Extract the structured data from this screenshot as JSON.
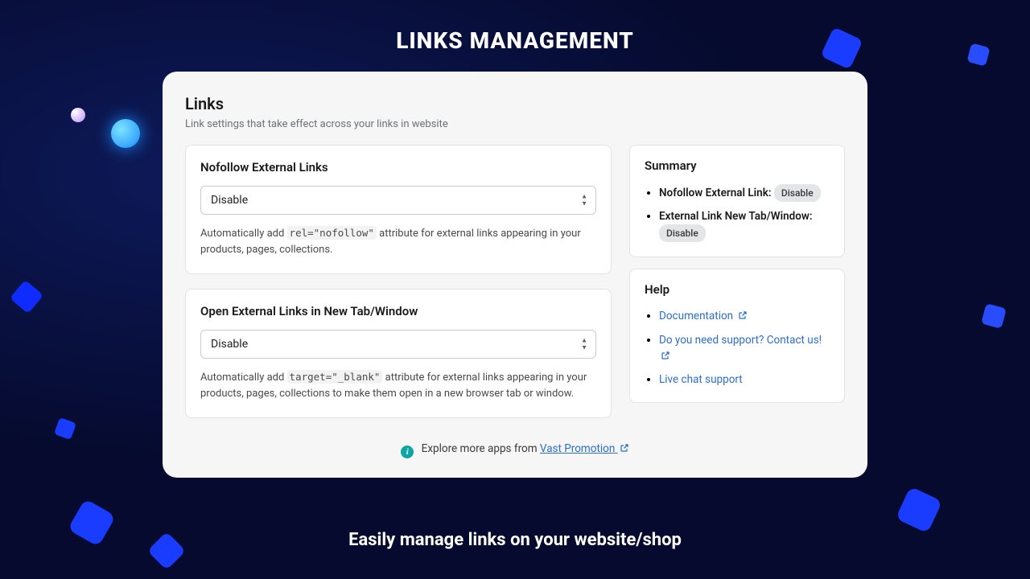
{
  "page": {
    "title": "LINKS MANAGEMENT",
    "tagline": "Easily manage links on your website/shop"
  },
  "panel": {
    "heading": "Links",
    "subheading": "Link settings that take effect across your links in website"
  },
  "cards": {
    "nofollow": {
      "title": "Nofollow External Links",
      "select_value": "Disable",
      "help_pre": "Automatically add ",
      "help_code": "rel=\"nofollow\"",
      "help_post": " attribute for external links appearing in your products, pages, collections."
    },
    "newtab": {
      "title": "Open External Links in New Tab/Window",
      "select_value": "Disable",
      "help_pre": "Automatically add ",
      "help_code": "target=\"_blank\"",
      "help_post": " attribute for external links appearing in your products, pages, collections to make them open in a new browser tab or window."
    }
  },
  "summary": {
    "title": "Summary",
    "items": [
      {
        "label": "Nofollow External Link:",
        "value": "Disable"
      },
      {
        "label": "External Link New Tab/Window:",
        "value": "Disable"
      }
    ]
  },
  "help": {
    "title": "Help",
    "links": {
      "docs": "Documentation",
      "support": "Do you need support? Contact us!",
      "livechat": "Live chat support"
    }
  },
  "footer": {
    "text": "Explore more apps from ",
    "link_label": "Vast Promotion"
  }
}
